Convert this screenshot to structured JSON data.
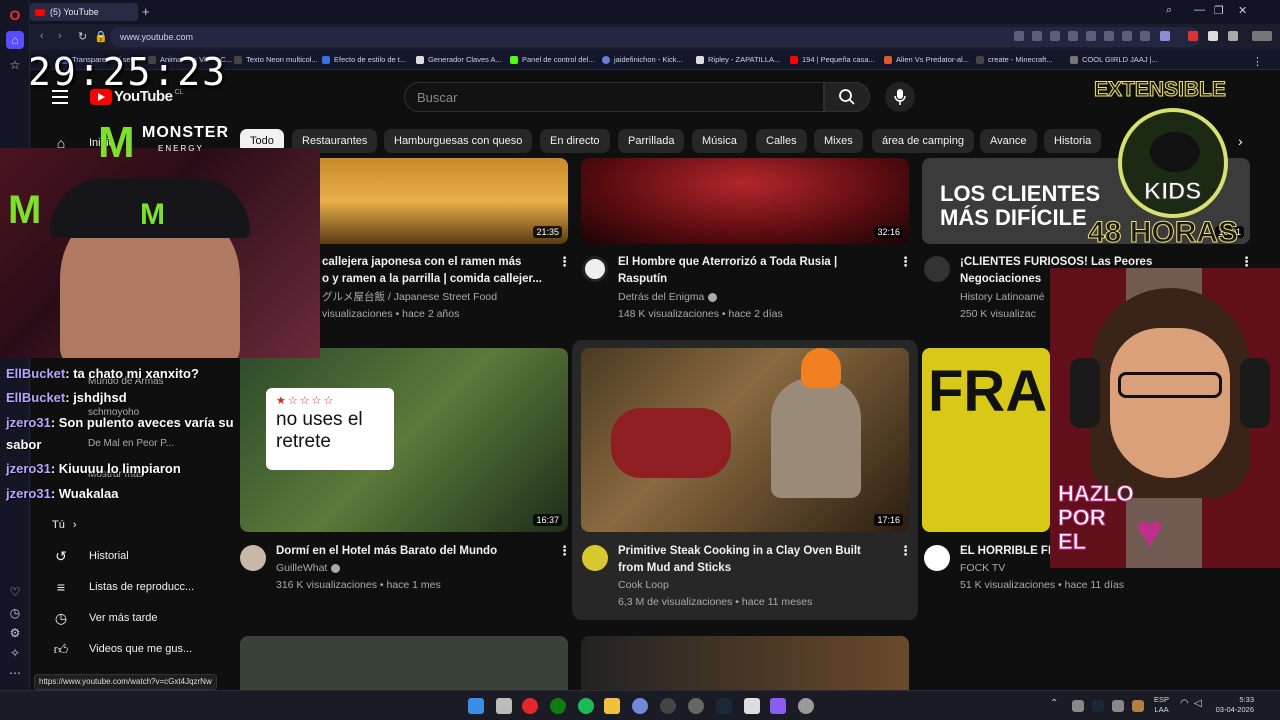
{
  "browser": {
    "tab_title": "(5) YouTube",
    "url": "www.youtube.com",
    "status_url": "https://www.youtube.com/watch?v=cGxt4JqzrNw",
    "bookmarks": [
      "Transparenta / semi...",
      "Animations Video C...",
      "Texto Neon multicol...",
      "Efecto de estilo de t...",
      "Generador Claves A...",
      "Panel de control del...",
      "jaidefinichon - Kick...",
      "Ripley - ZAPATILLA...",
      "194 | Pequeña casa...",
      "Alien Vs Predator-al...",
      "create - Minecraft...",
      "COOL GIRLD JAAJ |..."
    ]
  },
  "overlay": {
    "clock": "29:25:23",
    "chat": [
      {
        "user": "EllBucket",
        "text": ": ta chato mi xanxito?"
      },
      {
        "user": "EllBucket",
        "text": ": jshdjhsd"
      },
      {
        "user": "jzero31",
        "text": ": Son pulento aveces varía su"
      },
      {
        "user": "",
        "text": "sabor"
      },
      {
        "user": "jzero31",
        "text": ": Kiuuuu lo limpiaron"
      },
      {
        "user": "jzero31",
        "text": ": Wuakalaa"
      }
    ],
    "monster_brand": "MONSTER",
    "monster_sub": "ENERGY",
    "badge_top": "EXTENSIBLE",
    "badge_brand": "KIDS",
    "badge_hours": "48 HORAS",
    "avatar_text": [
      "HAZLO",
      "POR",
      "EL"
    ]
  },
  "youtube": {
    "logo": "YouTube",
    "country": "CL",
    "search_placeholder": "Buscar",
    "chips": [
      "Todo",
      "Restaurantes",
      "Hamburguesas con queso",
      "En directo",
      "Parrillada",
      "Música",
      "Calles",
      "Mixes",
      "área de camping",
      "Avance",
      "Historia"
    ],
    "sidebar": {
      "home": "Inicio",
      "subs": [
        "Mundo de Armas",
        "schmoyoho",
        "De Mal en Peor P...",
        "Mostrar más"
      ],
      "you": "Tú",
      "items": [
        "Historial",
        "Listas de reproducc...",
        "Ver más tarde",
        "Videos que me gus..."
      ]
    },
    "videos": [
      {
        "title_lines": [
          "callejera japonesa con el ramen más",
          "o y ramen a la parrilla | comida callejer..."
        ],
        "channel": "グルメ屋台飯 / Japanese Street Food",
        "meta": "visualizaciones • hace 2 años",
        "duration": "21:35"
      },
      {
        "title_lines": [
          "El Hombre que Aterrorizó a Toda Rusia |",
          "Rasputín"
        ],
        "channel": "Detrás del Enigma",
        "meta": "148 K visualizaciones • hace 2 días",
        "duration": "32:16",
        "thumb_text": ""
      },
      {
        "title_lines": [
          "¡CLIENTES FURIOSOS! Las Peores",
          "Negociaciones"
        ],
        "channel": "History Latinoamé",
        "meta": "250 K visualizac",
        "duration": "10:01",
        "thumb_text": [
          "LOS CLIENTES",
          "MÁS DIFÍCILE"
        ]
      },
      {
        "title_lines": [
          "Dormí en el Hotel más Barato del Mundo"
        ],
        "channel": "GuilleWhat",
        "meta": "316 K visualizaciones • hace 1 mes",
        "duration": "16:37",
        "thumb_text": [
          "no uses el",
          "retrete"
        ]
      },
      {
        "title_lines": [
          "Primitive Steak Cooking in a Clay Oven Built",
          "from Mud and Sticks"
        ],
        "channel": "Cook Loop",
        "meta": "6,3 M de visualizaciones • hace 11 meses",
        "duration": "17:16"
      },
      {
        "title_lines": [
          "EL HORRIBLE FI"
        ],
        "channel": "FOCK TV",
        "meta": "51 K visualizaciones • hace 11 días",
        "thumb_text": [
          "FRA"
        ]
      }
    ]
  },
  "taskbar": {
    "lang1": "ESP",
    "lang2": "LAA",
    "time": "5:33",
    "date": "03-04-2026"
  }
}
